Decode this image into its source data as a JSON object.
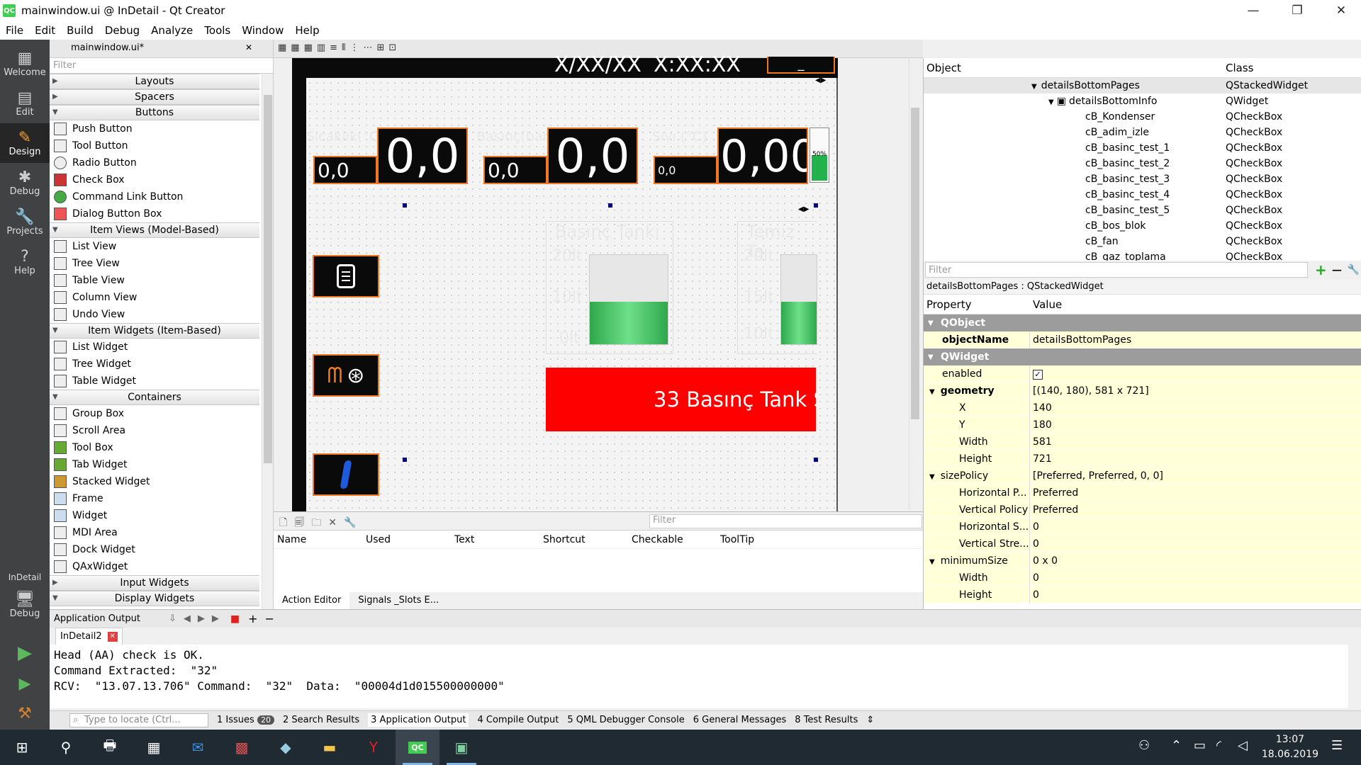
{
  "window": {
    "title": "mainwindow.ui @ InDetail - Qt Creator",
    "app_icon": "QC"
  },
  "menu": [
    "File",
    "Edit",
    "Build",
    "Debug",
    "Analyze",
    "Tools",
    "Window",
    "Help"
  ],
  "modes": [
    {
      "label": "Welcome",
      "icon": "grid-icon"
    },
    {
      "label": "Edit",
      "icon": "document-icon"
    },
    {
      "label": "Design",
      "icon": "pencil-icon"
    },
    {
      "label": "Debug",
      "icon": "bug-icon"
    },
    {
      "label": "Projects",
      "icon": "wrench-icon"
    },
    {
      "label": "Help",
      "icon": "help-icon"
    }
  ],
  "kit": {
    "project": "InDetail",
    "mode": "Debug"
  },
  "editor_tab": {
    "file": "mainwindow.ui*"
  },
  "widget_box": {
    "filter_placeholder": "Filter",
    "categories": {
      "layouts": "Layouts",
      "spacers": "Spacers",
      "buttons": "Buttons",
      "item_views": "Item Views (Model-Based)",
      "item_widgets": "Item Widgets (Item-Based)",
      "containers": "Containers",
      "input_widgets": "Input Widgets",
      "display_widgets": "Display Widgets"
    },
    "buttons": [
      "Push Button",
      "Tool Button",
      "Radio Button",
      "Check Box",
      "Command Link Button",
      "Dialog Button Box"
    ],
    "item_views": [
      "List View",
      "Tree View",
      "Table View",
      "Column View",
      "Undo View"
    ],
    "item_widgets": [
      "List Widget",
      "Tree Widget",
      "Table Widget"
    ],
    "containers": [
      "Group Box",
      "Scroll Area",
      "Tool Box",
      "Tab Widget",
      "Stacked Widget",
      "Frame",
      "Widget",
      "MDI Area",
      "Dock Widget",
      "QAxWidget"
    ]
  },
  "form": {
    "date": "X/XX/XX",
    "time": "X:XX:XX",
    "menu_glyph": "_",
    "tiles": [
      {
        "label": "Sıcaklık(°C)",
        "small": "0,0",
        "big": "0,0"
      },
      {
        "label": "Basınç(bar)",
        "small": "0,0",
        "big": "0,0"
      },
      {
        "label": "Sıvı (°C)",
        "small": "0,0",
        "big": "0,00"
      }
    ],
    "level_percent": "50%",
    "level_fraction": 0.5,
    "tanks": [
      {
        "title": "Basınç Tankı",
        "ticks": [
          "20lt",
          "10lt",
          "0lt"
        ],
        "fill": 0.48
      },
      {
        "title": "Temiz Ta",
        "ticks": [
          "20lt",
          "15lt",
          "10lt"
        ],
        "fill": 0.48
      }
    ],
    "banner": "33 Basınç Tank S"
  },
  "action_editor": {
    "filter_placeholder": "Filter",
    "columns": [
      "Name",
      "Used",
      "Text",
      "Shortcut",
      "Checkable",
      "ToolTip"
    ],
    "tabs": [
      "Action Editor",
      "Signals _Slots E..."
    ]
  },
  "object_inspector": {
    "columns": [
      "Object",
      "Class"
    ],
    "rows": [
      {
        "name": "detailsBottomPages",
        "cls": "QStackedWidget",
        "level": 0
      },
      {
        "name": "detailsBottomInfo",
        "cls": "QWidget",
        "level": 1
      },
      {
        "name": "cB_Kondenser",
        "cls": "QCheckBox",
        "level": 2
      },
      {
        "name": "cB_adim_izle",
        "cls": "QCheckBox",
        "level": 2
      },
      {
        "name": "cB_basinc_test_1",
        "cls": "QCheckBox",
        "level": 2
      },
      {
        "name": "cB_basinc_test_2",
        "cls": "QCheckBox",
        "level": 2
      },
      {
        "name": "cB_basinc_test_3",
        "cls": "QCheckBox",
        "level": 2
      },
      {
        "name": "cB_basinc_test_4",
        "cls": "QCheckBox",
        "level": 2
      },
      {
        "name": "cB_basinc_test_5",
        "cls": "QCheckBox",
        "level": 2
      },
      {
        "name": "cB_bos_blok",
        "cls": "QCheckBox",
        "level": 2
      },
      {
        "name": "cB_fan",
        "cls": "QCheckBox",
        "level": 2
      },
      {
        "name": "cB_gaz_toplama",
        "cls": "QCheckBox",
        "level": 2
      }
    ]
  },
  "property_editor": {
    "filter_placeholder": "Filter",
    "context": "detailsBottomPages : QStackedWidget",
    "columns": [
      "Property",
      "Value"
    ],
    "groups": {
      "qobject": "QObject",
      "qwidget": "QWidget"
    },
    "objectName": {
      "name": "objectName",
      "value": "detailsBottomPages"
    },
    "enabled": {
      "name": "enabled"
    },
    "geometry": {
      "name": "geometry",
      "value": "[(140, 180), 581 x 721]",
      "x": "140",
      "y": "180",
      "w": "581",
      "h": "721",
      "lx": "X",
      "ly": "Y",
      "lw": "Width",
      "lh": "Height"
    },
    "sizePolicy": {
      "name": "sizePolicy",
      "value": "[Preferred, Preferred, 0, 0]",
      "rows": [
        [
          "Horizontal P...",
          "Preferred"
        ],
        [
          "Vertical Policy",
          "Preferred"
        ],
        [
          "Horizontal S...",
          "0"
        ],
        [
          "Vertical Stre...",
          "0"
        ]
      ]
    },
    "minimumSize": {
      "name": "minimumSize",
      "value": "0 x 0",
      "rows": [
        [
          "Width",
          "0"
        ],
        [
          "Height",
          "0"
        ]
      ]
    }
  },
  "output": {
    "title": "Application Output",
    "tab": "InDetail2",
    "lines": [
      "Head (AA) check is OK.",
      "Command Extracted:  \"32\"",
      "RCV:  \"13.07.13.706\" Command:  \"32\"  Data:  \"00004d1d015500000000\""
    ]
  },
  "statusbar": {
    "locator_placeholder": "Type to locate (Ctrl...",
    "panes": [
      {
        "num": "1",
        "label": "Issues",
        "badge": "20"
      },
      {
        "num": "2",
        "label": "Search Results"
      },
      {
        "num": "3",
        "label": "Application Output"
      },
      {
        "num": "4",
        "label": "Compile Output"
      },
      {
        "num": "5",
        "label": "QML Debugger Console"
      },
      {
        "num": "6",
        "label": "General Messages"
      },
      {
        "num": "8",
        "label": "Test Results"
      }
    ]
  },
  "taskbar": {
    "time": "13:07",
    "date": "18.06.2019"
  },
  "colors": {
    "accent_orange": "#f07820",
    "banner_red": "#ff0000",
    "modebar": "#404244",
    "tank_green": "#3cc85a"
  }
}
